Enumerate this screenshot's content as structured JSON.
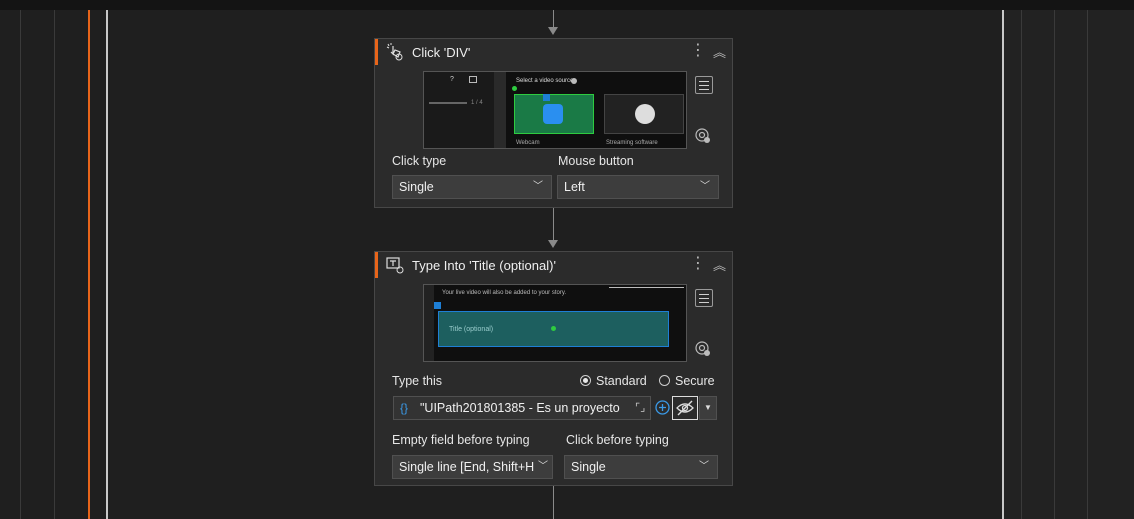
{
  "card1": {
    "title": "Click 'DIV'",
    "preview": {
      "heading": "Select a video source",
      "counter": "1 / 4",
      "left_label": "Webcam",
      "right_label": "Streaming software"
    },
    "click_type_label": "Click type",
    "click_type_value": "Single",
    "mouse_button_label": "Mouse button",
    "mouse_button_value": "Left"
  },
  "card2": {
    "title": "Type Into 'Title (optional)'",
    "preview": {
      "caption": "Your live video will also be added to your story.",
      "field_placeholder": "Title (optional)"
    },
    "type_this_label": "Type this",
    "mode_standard": "Standard",
    "mode_secure": "Secure",
    "text_value": "\"UIPath201801385 - Es un proyecto",
    "expr_symbol": "{}",
    "empty_field_label": "Empty field before typing",
    "empty_field_value": "Single line [End, Shift+H",
    "click_before_label": "Click before typing",
    "click_before_value": "Single"
  },
  "colors": {
    "accent": "#e8651a",
    "background": "#1f1f1f",
    "card": "#2b2b2b",
    "selection": "#1f9e3a",
    "highlight": "#1e7fd6"
  },
  "icons": [
    "click-activity-icon",
    "type-into-activity-icon",
    "more-options-icon",
    "collapse-icon",
    "menu-icon",
    "indicate-target-icon",
    "chevron-down-icon",
    "plus-circle-icon",
    "hidden-eye-icon",
    "expand-editor-icon"
  ]
}
